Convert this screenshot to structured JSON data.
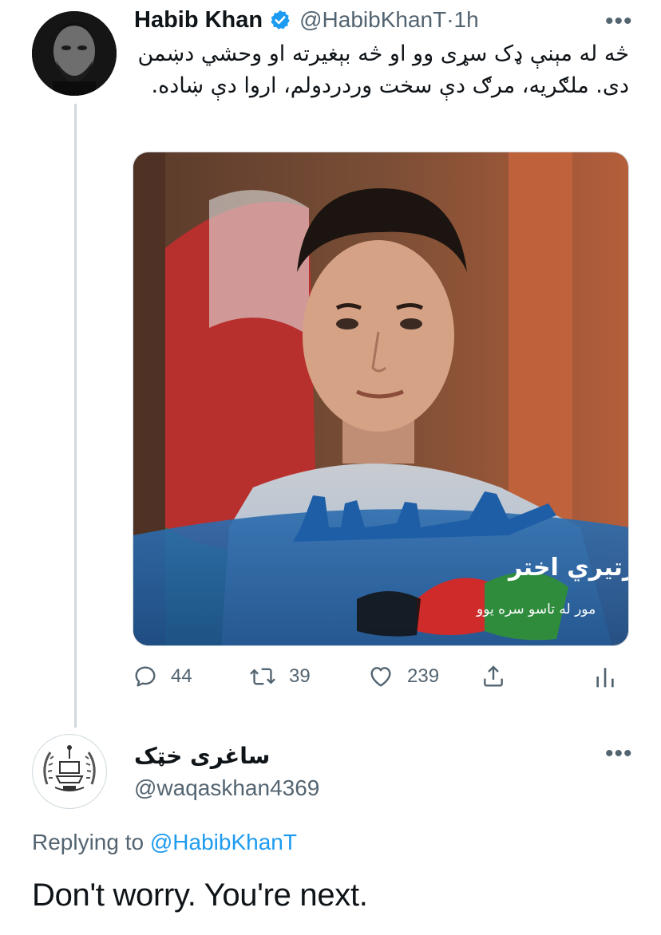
{
  "tweet": {
    "display_name": "Habib Khan",
    "handle": "@HabibKhanT",
    "separator": "·",
    "time": "1h",
    "text": "څه له مېنې ډک سړی وو او څه بېغيرته او وحشي دښمن دی. ملګريه، مرګ دې سخت وردردولم، اروا دې ښاده.",
    "media": {
      "title": "د سرتيري اختر",
      "subtitle": "مور له تاسو سره يوو"
    },
    "actions": {
      "reply_icon": "reply-icon",
      "reply_count": "44",
      "retweet_icon": "retweet-icon",
      "retweet_count": "39",
      "like_icon": "heart-icon",
      "like_count": "239",
      "share_icon": "share-icon",
      "analytics_icon": "analytics-icon"
    }
  },
  "reply": {
    "display_name": "ساغرى خټک",
    "handle": "@waqaskhan4369",
    "replying_prefix": "Replying to",
    "replying_handle": "@HabibKhanT",
    "text": "Don't worry. You're next."
  },
  "colors": {
    "text_primary": "#0f1419",
    "text_secondary": "#536471",
    "accent": "#1d9bf0",
    "divider": "#cfd9de"
  }
}
